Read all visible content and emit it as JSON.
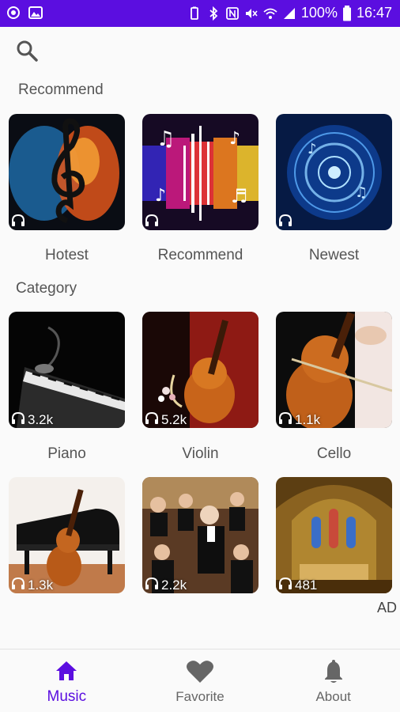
{
  "status_bar": {
    "battery_percent": "100%",
    "time": "16:47"
  },
  "search": {
    "icon": "search-icon"
  },
  "recommend": {
    "title": "Recommend",
    "items": [
      {
        "label": "Hotest"
      },
      {
        "label": "Recommend"
      },
      {
        "label": "Newest"
      }
    ]
  },
  "category": {
    "title": "Category",
    "items": [
      {
        "label": "Piano",
        "count": "3.2k"
      },
      {
        "label": "Violin",
        "count": "5.2k"
      },
      {
        "label": "Cello",
        "count": "1.1k"
      },
      {
        "label": "",
        "count": "1.3k"
      },
      {
        "label": "",
        "count": "2.2k"
      },
      {
        "label": "",
        "count": "481"
      }
    ]
  },
  "ad_label": "AD",
  "bottom_nav": {
    "tabs": [
      {
        "label": "Music",
        "icon": "home-icon"
      },
      {
        "label": "Favorite",
        "icon": "heart-icon"
      },
      {
        "label": "About",
        "icon": "bell-icon"
      }
    ]
  },
  "colors": {
    "accent": "#5b0ee0",
    "inactive": "#666666"
  }
}
